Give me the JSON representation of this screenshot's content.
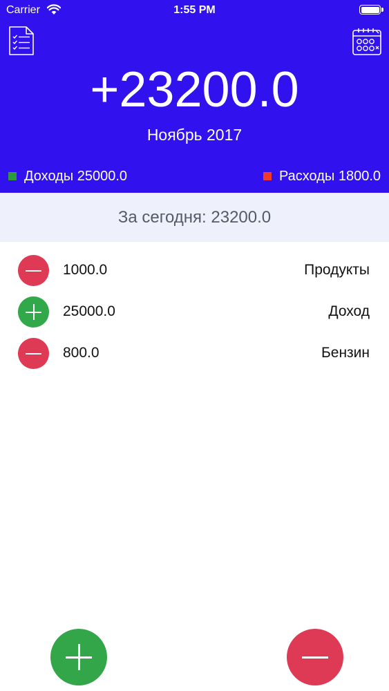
{
  "status_bar": {
    "carrier": "Carrier",
    "time": "1:55 PM"
  },
  "header": {
    "background_color": "#3112ef",
    "report_icon": "report-checklist-icon",
    "calendar_icon": "calendar-icon",
    "balance": "+23200.0",
    "month": "Ноябрь 2017",
    "income_label": "Доходы 25000.0",
    "expense_label": "Расходы 1800.0",
    "income_color": "#2f9a3c",
    "expense_color": "#f23a2c"
  },
  "today": {
    "label": "За сегодня: 23200.0"
  },
  "transactions": [
    {
      "type": "expense",
      "amount": "1000.0",
      "category": "Продукты"
    },
    {
      "type": "income",
      "amount": "25000.0",
      "category": "Доход"
    },
    {
      "type": "expense",
      "amount": "800.0",
      "category": "Бензин"
    }
  ],
  "actions": {
    "add_icon": "plus-icon",
    "subtract_icon": "minus-icon",
    "add_color": "#33a64a",
    "subtract_color": "#df3a55"
  }
}
